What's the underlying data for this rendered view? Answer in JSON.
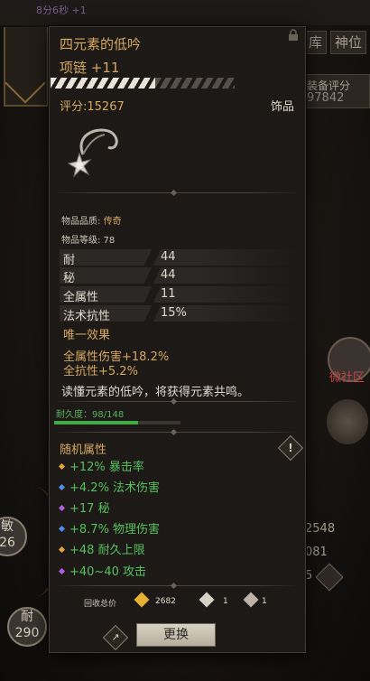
{
  "background": {
    "timer": "8分6秒 +1",
    "tabs": [
      "库",
      "神位"
    ],
    "equip_score_label": "装备评分",
    "equip_score_value": "97842",
    "micro_label": "微社区",
    "left_circle_1": {
      "label": "敏",
      "value": "26"
    },
    "left_circle_2": {
      "label": "耐",
      "value": "290"
    },
    "right_nums": [
      "2548",
      "081",
      "5"
    ]
  },
  "tooltip": {
    "name": "四元素的低吟",
    "slot_line": "项链 +11",
    "score": "评分:15267",
    "category": "饰品",
    "quality_label": "物品品质: ",
    "quality_value": "传奇",
    "level_line": "物品等级: 78",
    "base_stats": [
      {
        "name": "耐",
        "value": "44"
      },
      {
        "name": "秘",
        "value": "44"
      },
      {
        "name": "全属性",
        "value": "11"
      },
      {
        "name": "法术抗性",
        "value": "15%"
      }
    ],
    "unique_header": "唯一效果",
    "unique_lines": [
      "全属性伤害+18.2%",
      "全抗性+5.2%"
    ],
    "flavor": "读懂元素的低吟，将获得元素共鸣。",
    "durability_text": "耐久度：98/148",
    "durability_fraction": 0.662,
    "random_header": "随机属性",
    "random_stats": [
      {
        "text": "+12% 暴击率",
        "color": "#e8a436"
      },
      {
        "text": "+4.2% 法术伤害",
        "color": "#4f8ee8"
      },
      {
        "text": "+17 秘",
        "color": "#b35ce0"
      },
      {
        "text": "+8.7% 物理伤害",
        "color": "#4f8ee8"
      },
      {
        "text": "+48 耐久上限",
        "color": "#e8a436"
      },
      {
        "text": "+40~40 攻击",
        "color": "#b35ce0"
      }
    ],
    "recycle_label": "回收总价",
    "recycle_items": [
      {
        "value": "2682",
        "icon": "gold-gem-icon",
        "color": "#e6b030"
      },
      {
        "value": "1",
        "icon": "silver-crystal-icon",
        "color": "#d8d2c8"
      },
      {
        "value": "1",
        "icon": "stone-icon",
        "color": "#bcb4aa"
      }
    ],
    "replace_button": "更换"
  }
}
